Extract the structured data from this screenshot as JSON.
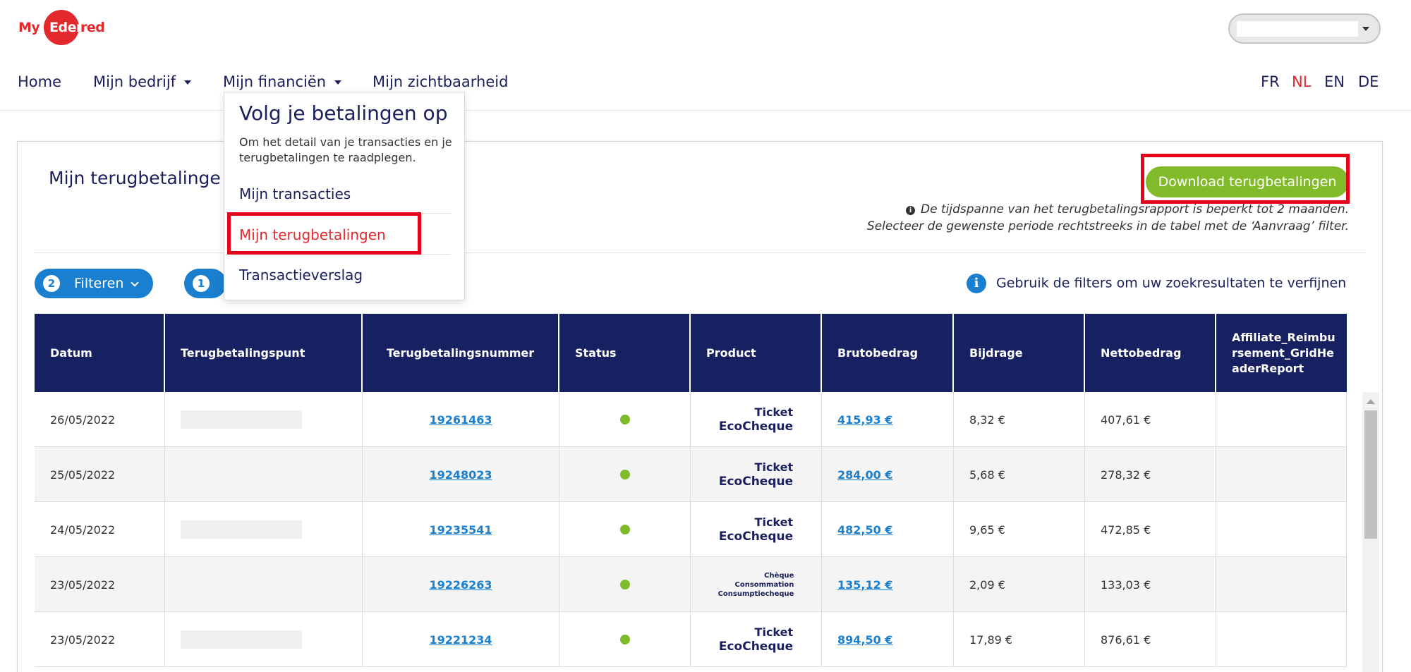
{
  "brand": {
    "logo_my": "My",
    "logo_edenred_a": "Eden",
    "logo_edenred_b": "red"
  },
  "nav": {
    "home": "Home",
    "company": "Mijn bedrijf",
    "finances": "Mijn financiën",
    "visibility": "Mijn zichtbaarheid"
  },
  "languages": [
    "FR",
    "NL",
    "EN",
    "DE"
  ],
  "active_language": "NL",
  "dropdown": {
    "title": "Volg je betalingen op",
    "description": "Om het detail van je transacties en je terugbetalingen te raadplegen.",
    "items": [
      "Mijn transacties",
      "Mijn terugbetalingen",
      "Transactieverslag"
    ]
  },
  "page": {
    "title": "Mijn terugbetalinge",
    "download_label": "Download terugbetalingen",
    "info_line1": "De tijdspanne van het terugbetalingsrapport is beperkt tot 2 maanden.",
    "info_line2": "Selecteer de gewenste periode rechtstreeks in de tabel met de ‘Aanvraag’ filter.",
    "info_icon": "i"
  },
  "filters": {
    "filter_count": "2",
    "filter_label": "Filteren",
    "second_count": "1",
    "hint": "Gebruik de filters om uw zoekresultaten te verfijnen",
    "hint_icon": "i"
  },
  "table": {
    "headers": [
      "Datum",
      "Terugbetalingspunt",
      "Terugbetalingsnummer",
      "Status",
      "Product",
      "Brutobedrag",
      "Bijdrage",
      "Nettobedrag",
      "Affiliate_Reimbursement_GridHeaderReport"
    ],
    "rows": [
      {
        "date": "26/05/2022",
        "number": "19261463",
        "product_l1": "Ticket",
        "product_l2": "EcoCheque",
        "gross": "415,93 €",
        "contribution": "8,32 €",
        "net": "407,61 €"
      },
      {
        "date": "25/05/2022",
        "number": "19248023",
        "product_l1": "Ticket",
        "product_l2": "EcoCheque",
        "gross": "284,00 €",
        "contribution": "5,68 €",
        "net": "278,32 €"
      },
      {
        "date": "24/05/2022",
        "number": "19235541",
        "product_l1": "Ticket",
        "product_l2": "EcoCheque",
        "gross": "482,50 €",
        "contribution": "9,65 €",
        "net": "472,85 €"
      },
      {
        "date": "23/05/2022",
        "number": "19226263",
        "product_l1": "Chèque",
        "product_l2": "Consommation",
        "product_l3": "Consumptiecheque",
        "gross": "135,12 €",
        "contribution": "2,09 €",
        "net": "133,03 €"
      },
      {
        "date": "23/05/2022",
        "number": "19221234",
        "product_l1": "Ticket",
        "product_l2": "EcoCheque",
        "gross": "894,50 €",
        "contribution": "17,89 €",
        "net": "876,61 €"
      }
    ]
  },
  "colors": {
    "brand_red": "#e4292c",
    "navy": "#172061",
    "green": "#82bb2a",
    "link_blue": "#1a7fcf",
    "highlight_red": "#e4041b"
  }
}
